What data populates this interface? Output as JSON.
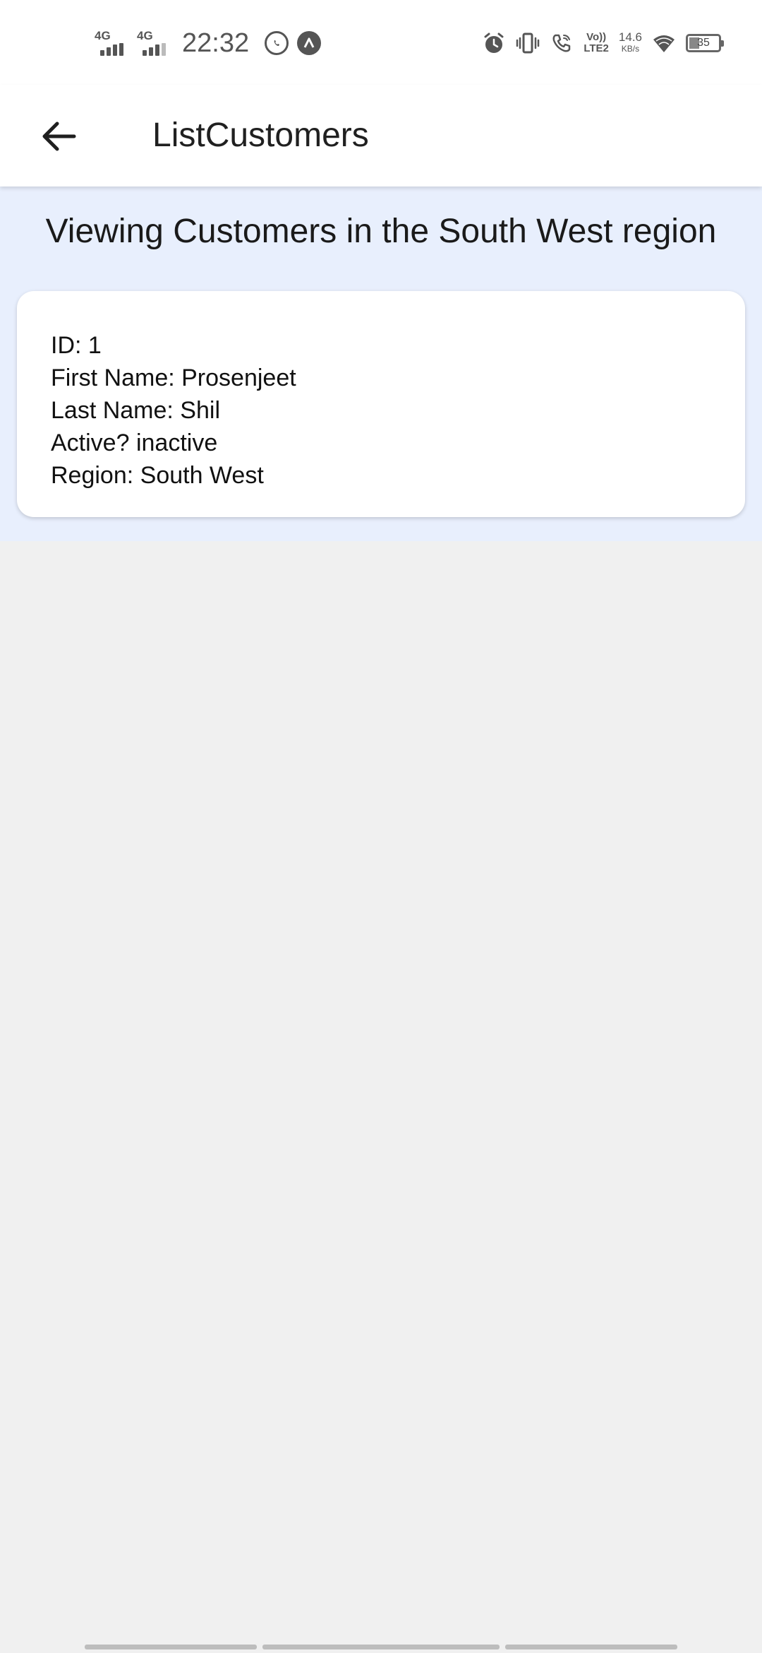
{
  "status_bar": {
    "signal_1_label": "4G",
    "signal_2_label": "4G",
    "time": "22:32",
    "volte_line1": "Vo))",
    "volte_line2": "LTE2",
    "speed_value": "14.6",
    "speed_unit": "KB/s",
    "battery_level": "35",
    "icons": [
      "whatsapp-icon",
      "app-a-icon",
      "alarm-icon",
      "vibrate-icon",
      "wifi-call-icon",
      "wifi-icon",
      "battery-icon"
    ]
  },
  "app_bar": {
    "title": "ListCustomers",
    "back_icon": "arrow-left-icon"
  },
  "main": {
    "heading": "Viewing Customers in the South West region",
    "customers": [
      {
        "id_line": "ID: 1",
        "first_name_line": "First Name: Prosenjeet",
        "last_name_line": "Last Name: Shil",
        "active_line": "Active? inactive",
        "region_line": "Region: South West"
      }
    ]
  },
  "colors": {
    "content_background": "#e8effd",
    "page_background": "#f0f0f0",
    "card_background": "#ffffff",
    "app_bar_background": "#ffffff"
  }
}
